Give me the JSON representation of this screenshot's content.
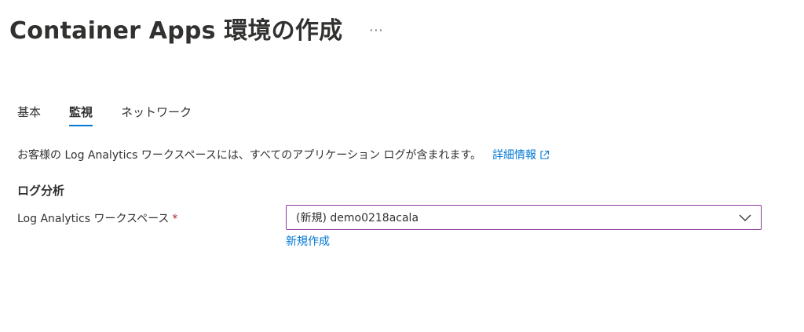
{
  "header": {
    "title": "Container Apps 環境の作成",
    "more_label": "···"
  },
  "tabs": [
    {
      "label": "基本",
      "active": false
    },
    {
      "label": "監視",
      "active": true
    },
    {
      "label": "ネットワーク",
      "active": false
    }
  ],
  "info": {
    "text": "お客様の Log Analytics ワークスペースには、すべてのアプリケーション ログが含まれます。",
    "link_label": "詳細情報",
    "link_icon": "external-link-icon"
  },
  "section": {
    "title": "ログ分析"
  },
  "workspace_field": {
    "label": "Log Analytics ワークスペース",
    "required_marker": "*",
    "selected_value": "(新規) demo0218acala",
    "chevron_icon": "chevron-down-icon",
    "create_new_label": "新規作成"
  },
  "colors": {
    "accent": "#0078d4",
    "required": "#a4262c",
    "focus_border": "#8a3c9e"
  }
}
